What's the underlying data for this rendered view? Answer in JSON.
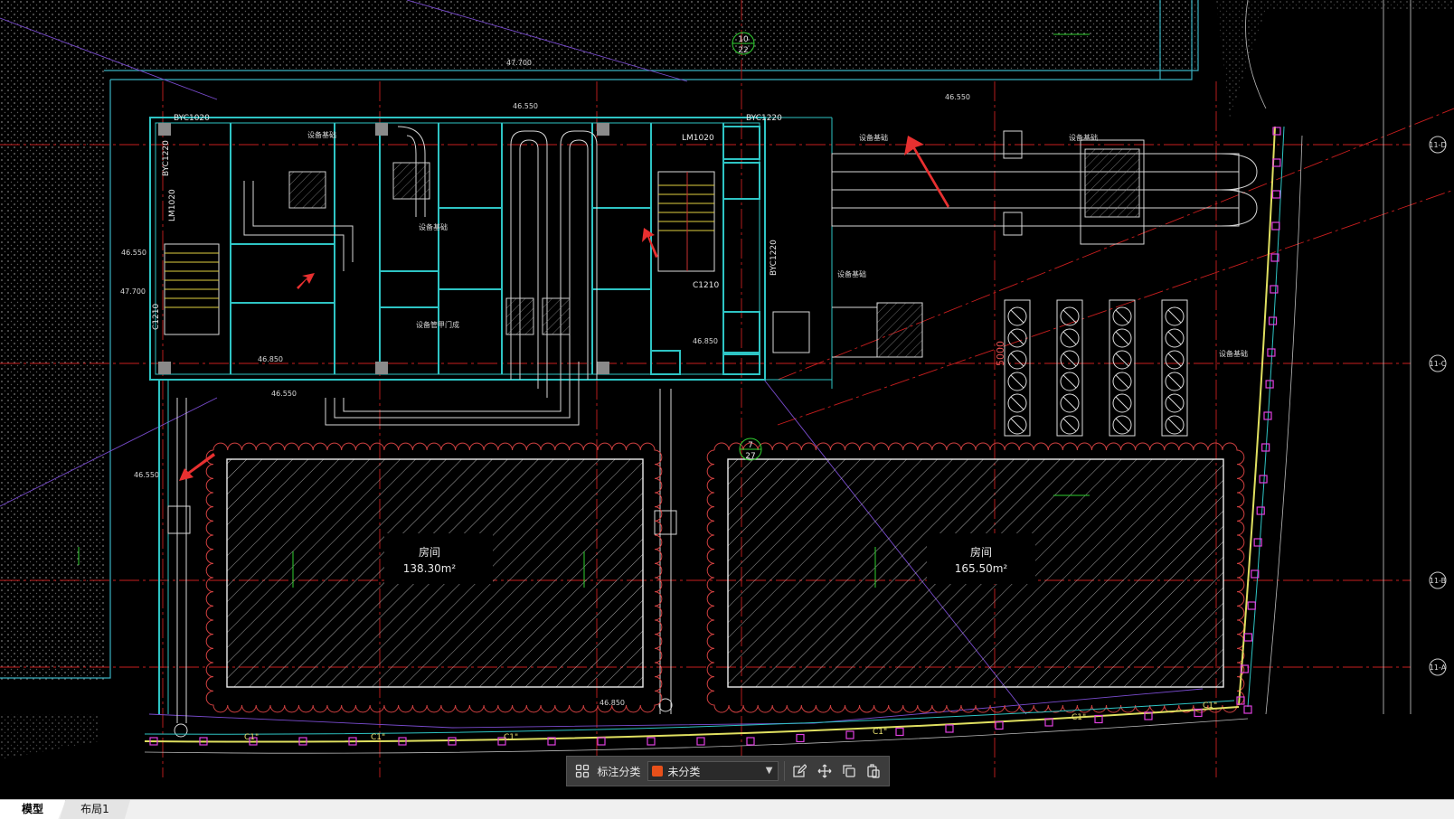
{
  "canvas": {
    "rooms": [
      {
        "name": "房间",
        "area": "138.30m²"
      },
      {
        "name": "房间",
        "area": "165.50m²"
      }
    ],
    "door_labels": [
      "BYC1020",
      "BYC1220",
      "LM1020",
      "LM1020",
      "C1210",
      "C1210",
      "BYC1220",
      "BYC1220"
    ],
    "grid_axis_labels": [
      "11-D",
      "11-C",
      "11-B",
      "11-A"
    ],
    "grid_bubbles": [
      {
        "top": "10",
        "bottom": "22"
      },
      {
        "top": "7",
        "bottom": "27"
      }
    ],
    "dimension_5000": "5000",
    "elevation_labels": [
      "46.550",
      "46.550",
      "46.550",
      "46.550",
      "47.700",
      "46.850",
      "46.850",
      "46.550",
      "46.850",
      "47.700"
    ],
    "equipment_labels": [
      "设备基础",
      "设备基础",
      "设备基础",
      "设备基础",
      "设备基础",
      "设备基础"
    ],
    "door_text": "设备管甲门成",
    "material_labels": [
      "C1\"",
      "C1\"",
      "C1\"",
      "C1\"",
      "C1\"",
      "C1\""
    ]
  },
  "toolbar": {
    "label": "标注分类",
    "selected_category": "未分类",
    "swatch_color": "#e8501a",
    "actions": [
      "edit-icon",
      "move-icon",
      "copy-icon",
      "paste-icon"
    ]
  },
  "tabs": [
    {
      "label": "模型",
      "active": true
    },
    {
      "label": "布局1",
      "active": false
    }
  ],
  "colors": {
    "background": "#000000",
    "wall_cyan": "#2ec4c4",
    "red_axis": "#d42020",
    "annotation_arrow": "#e83030",
    "outline_purple": "#8a5ad8"
  }
}
